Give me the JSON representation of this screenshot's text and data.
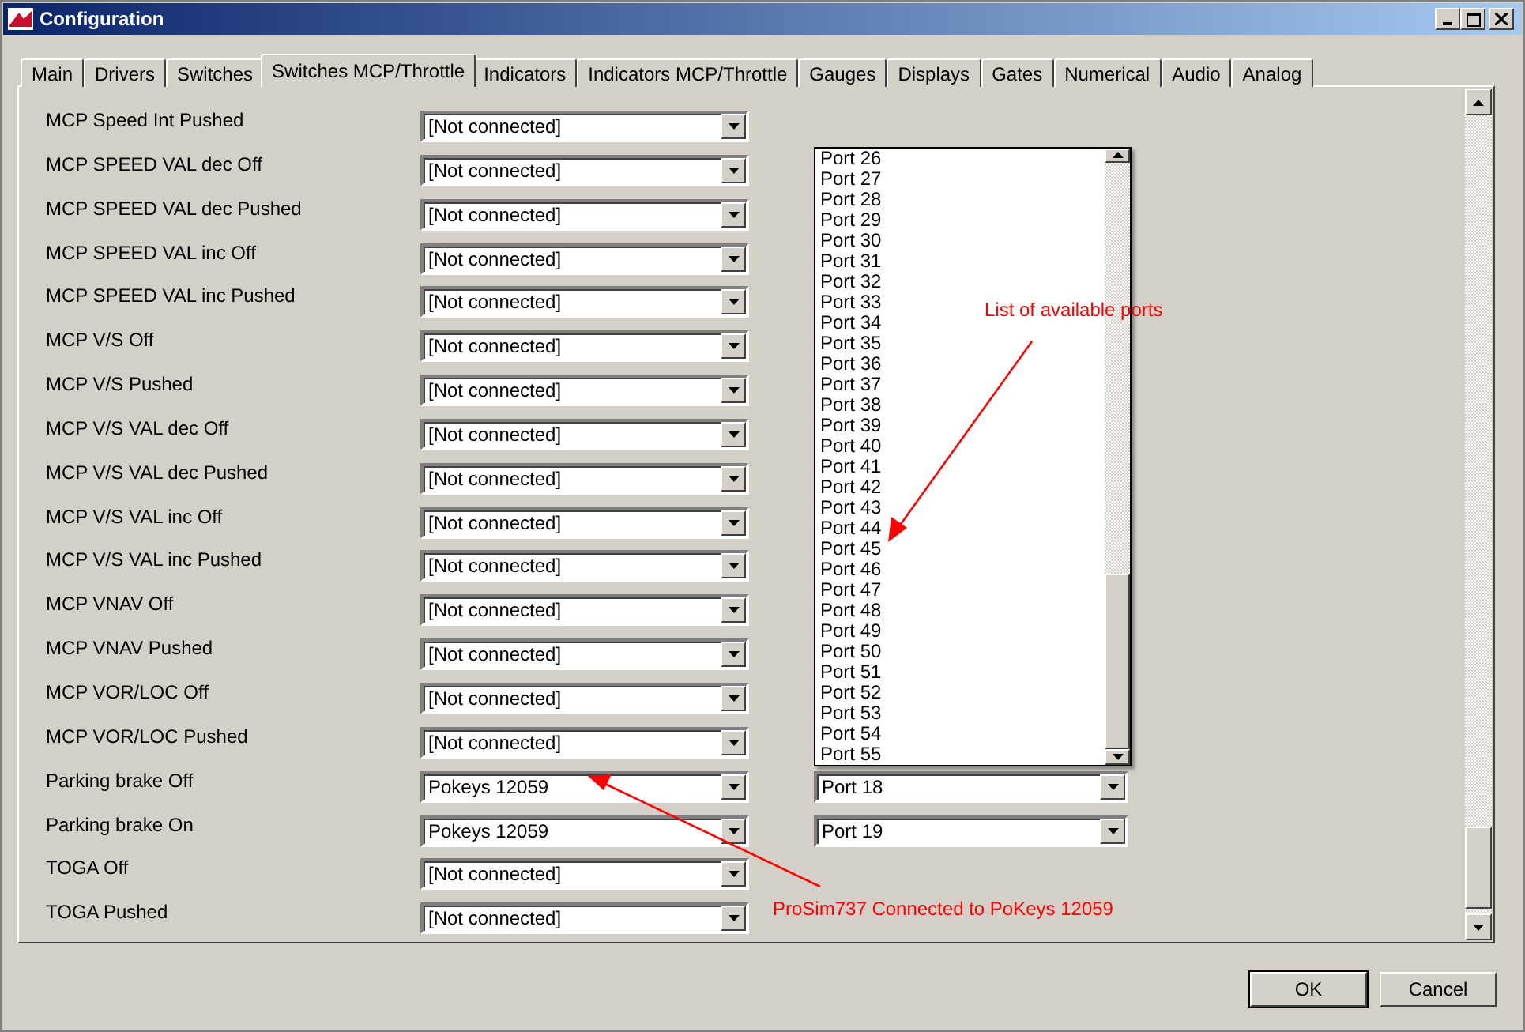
{
  "window": {
    "title": "Configuration"
  },
  "tabs": [
    {
      "label": "Main",
      "selected": false
    },
    {
      "label": "Drivers",
      "selected": false
    },
    {
      "label": "Switches",
      "selected": false
    },
    {
      "label": "Switches MCP/Throttle",
      "selected": true
    },
    {
      "label": "Indicators",
      "selected": false
    },
    {
      "label": "Indicators MCP/Throttle",
      "selected": false
    },
    {
      "label": "Gauges",
      "selected": false
    },
    {
      "label": "Displays",
      "selected": false
    },
    {
      "label": "Gates",
      "selected": false
    },
    {
      "label": "Numerical",
      "selected": false
    },
    {
      "label": "Audio",
      "selected": false
    },
    {
      "label": "Analog",
      "selected": false
    }
  ],
  "rows": [
    {
      "label": "MCP Speed Int Pushed",
      "device": "[Not connected]"
    },
    {
      "label": "MCP SPEED VAL dec Off",
      "device": "[Not connected]"
    },
    {
      "label": "MCP SPEED VAL dec Pushed",
      "device": "[Not connected]"
    },
    {
      "label": "MCP SPEED VAL inc Off",
      "device": "[Not connected]"
    },
    {
      "label": "MCP SPEED VAL inc Pushed",
      "device": "[Not connected]"
    },
    {
      "label": "MCP V/S Off",
      "device": "[Not connected]"
    },
    {
      "label": "MCP V/S Pushed",
      "device": "[Not connected]"
    },
    {
      "label": "MCP V/S VAL dec Off",
      "device": "[Not connected]"
    },
    {
      "label": "MCP V/S VAL dec Pushed",
      "device": "[Not connected]"
    },
    {
      "label": "MCP V/S VAL inc Off",
      "device": "[Not connected]"
    },
    {
      "label": "MCP V/S VAL inc Pushed",
      "device": "[Not connected]"
    },
    {
      "label": "MCP VNAV Off",
      "device": "[Not connected]"
    },
    {
      "label": "MCP VNAV Pushed",
      "device": "[Not connected]"
    },
    {
      "label": "MCP VOR/LOC Off",
      "device": "[Not connected]"
    },
    {
      "label": "MCP VOR/LOC Pushed",
      "device": "[Not connected]"
    },
    {
      "label": "Parking brake Off",
      "device": "Pokeys 12059",
      "port": "Port 18"
    },
    {
      "label": "Parking brake On",
      "device": "Pokeys 12059",
      "port": "Port 19"
    },
    {
      "label": "TOGA Off",
      "device": "[Not connected]"
    },
    {
      "label": "TOGA Pushed",
      "device": "[Not connected]"
    }
  ],
  "port_dropdown": {
    "items": [
      "Port 26",
      "Port 27",
      "Port 28",
      "Port 29",
      "Port 30",
      "Port 31",
      "Port 32",
      "Port 33",
      "Port 34",
      "Port 35",
      "Port 36",
      "Port 37",
      "Port 38",
      "Port 39",
      "Port 40",
      "Port 41",
      "Port 42",
      "Port 43",
      "Port 44",
      "Port 45",
      "Port 46",
      "Port 47",
      "Port 48",
      "Port 49",
      "Port 50",
      "Port 51",
      "Port 52",
      "Port 53",
      "Port 54",
      "Port 55"
    ]
  },
  "annotations": [
    {
      "text": "List of available ports"
    },
    {
      "text": "ProSim737 Connected to PoKeys 12059"
    }
  ],
  "buttons": [
    "OK",
    "Cancel"
  ]
}
